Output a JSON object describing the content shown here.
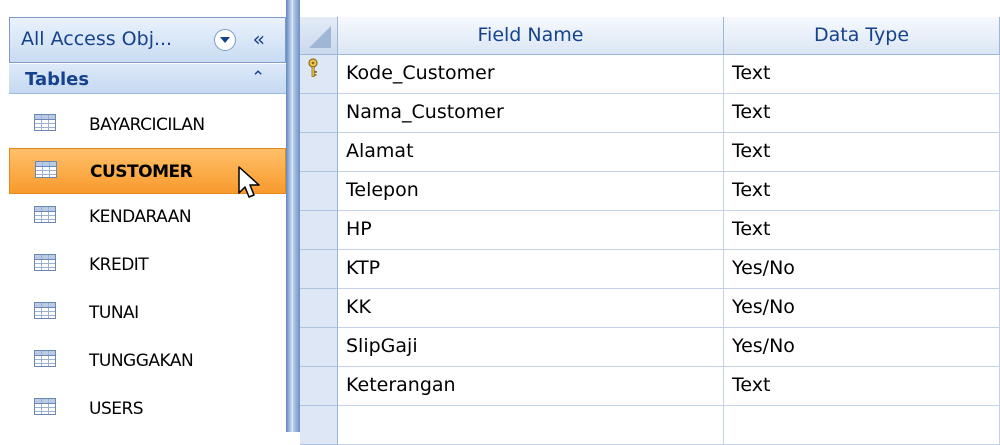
{
  "nav": {
    "title": "All Access Obj...",
    "dropdown_icon": "chevron-down-icon",
    "collapse_label": "«",
    "group": {
      "title": "Tables",
      "chevron": "⌃"
    },
    "items": [
      {
        "label": "BAYARCICILAN",
        "selected": false
      },
      {
        "label": "CUSTOMER",
        "selected": true
      },
      {
        "label": "KENDARAAN",
        "selected": false
      },
      {
        "label": "KREDIT",
        "selected": false
      },
      {
        "label": "TUNAI",
        "selected": false
      },
      {
        "label": "TUNGGAKAN",
        "selected": false
      },
      {
        "label": "USERS",
        "selected": false
      }
    ]
  },
  "grid": {
    "headers": {
      "field_name": "Field Name",
      "data_type": "Data Type"
    },
    "rows": [
      {
        "field": "Kode_Customer",
        "type": "Text",
        "primary_key": true
      },
      {
        "field": "Nama_Customer",
        "type": "Text"
      },
      {
        "field": "Alamat",
        "type": "Text"
      },
      {
        "field": "Telepon",
        "type": "Text"
      },
      {
        "field": "HP",
        "type": "Text"
      },
      {
        "field": "KTP",
        "type": "Yes/No"
      },
      {
        "field": "KK",
        "type": "Yes/No"
      },
      {
        "field": "SlipGaji",
        "type": "Yes/No"
      },
      {
        "field": "Keterangan",
        "type": "Text"
      },
      {
        "field": "",
        "type": ""
      }
    ]
  },
  "colors": {
    "accent": "#15428b",
    "selection": "#f89a2c",
    "header_bg": "#dbe6f4"
  }
}
